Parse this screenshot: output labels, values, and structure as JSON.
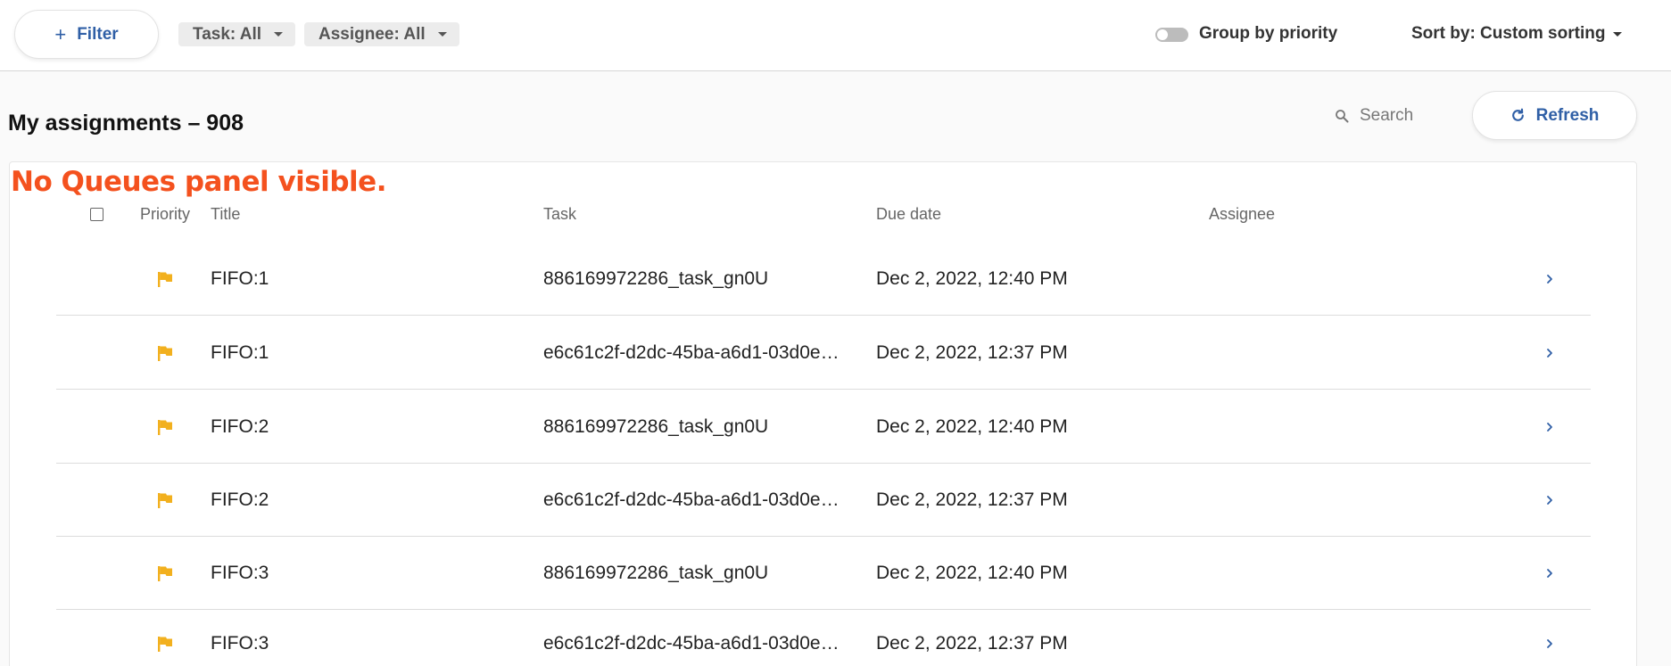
{
  "toolbar": {
    "filter_label": "Filter",
    "task_chip": "Task: All",
    "assignee_chip": "Assignee: All",
    "group_by_label": "Group by priority",
    "group_by_enabled": false,
    "sort_label": "Sort by: Custom sorting"
  },
  "header": {
    "title": "My assignments – 908",
    "search_placeholder": "Search",
    "refresh_label": "Refresh"
  },
  "annotation": "No Queues panel visible.",
  "table": {
    "columns": [
      "Priority",
      "Title",
      "Task",
      "Due date",
      "Assignee"
    ],
    "rows": [
      {
        "title": "FIFO:1",
        "task": "886169972286_task_gn0U",
        "due": "Dec 2, 2022, 12:40 PM",
        "assignee": ""
      },
      {
        "title": "FIFO:1",
        "task": "e6c61c2f-d2dc-45ba-a6d1-03d0e…",
        "due": "Dec 2, 2022, 12:37 PM",
        "assignee": ""
      },
      {
        "title": "FIFO:2",
        "task": "886169972286_task_gn0U",
        "due": "Dec 2, 2022, 12:40 PM",
        "assignee": ""
      },
      {
        "title": "FIFO:2",
        "task": "e6c61c2f-d2dc-45ba-a6d1-03d0e…",
        "due": "Dec 2, 2022, 12:37 PM",
        "assignee": ""
      },
      {
        "title": "FIFO:3",
        "task": "886169972286_task_gn0U",
        "due": "Dec 2, 2022, 12:40 PM",
        "assignee": ""
      },
      {
        "title": "FIFO:3",
        "task": "e6c61c2f-d2dc-45ba-a6d1-03d0e…",
        "due": "Dec 2, 2022, 12:37 PM",
        "assignee": ""
      }
    ]
  },
  "icons": {
    "priority": "flag-icon",
    "row_open": "chevron-right-icon",
    "search": "search-icon",
    "refresh": "refresh-icon"
  },
  "colors": {
    "accent": "#2f5fa6",
    "flag": "#f2b01e",
    "annotation": "#f4511e"
  }
}
